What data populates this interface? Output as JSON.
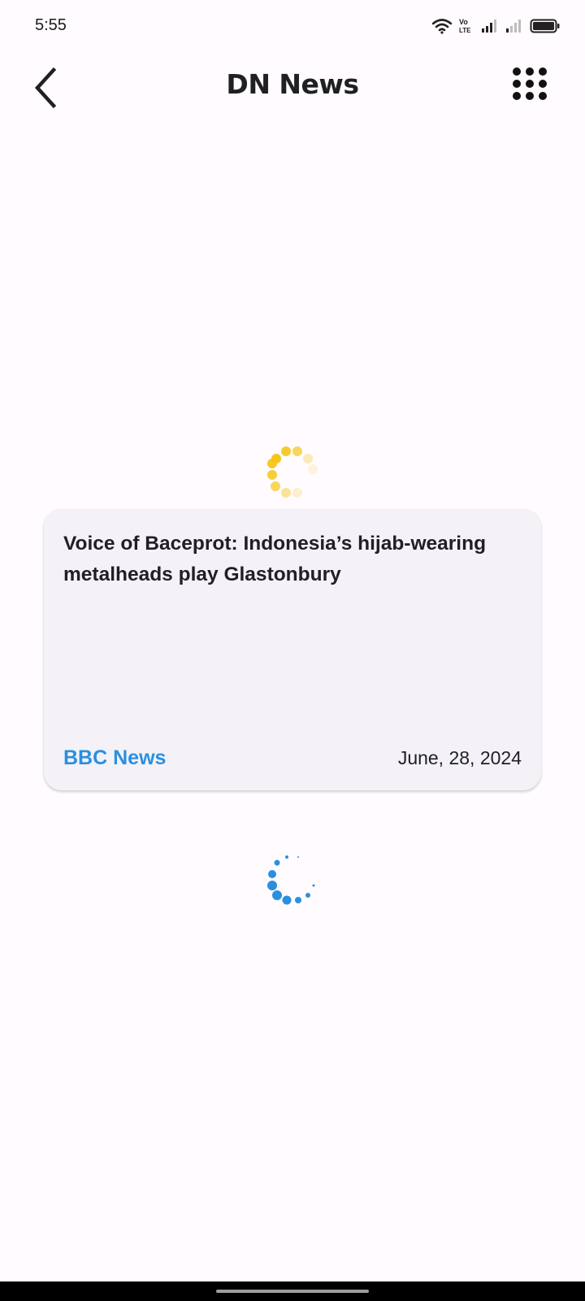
{
  "status_bar": {
    "time": "5:55",
    "volte_label_top": "Vo",
    "volte_label_bottom": "LTE",
    "icons": [
      "wifi-icon",
      "volte-icon",
      "signal-sim1-icon",
      "signal-sim2-icon",
      "battery-icon"
    ]
  },
  "app_bar": {
    "title": "DN News",
    "back_icon": "chevron-left-icon",
    "menu_icon": "grid-dots-icon"
  },
  "article": {
    "title": "Voice of Baceprot: Indonesia’s hijab-wearing metalheads play Glastonbury",
    "source": "BBC News",
    "date": "June, 28, 2024"
  },
  "colors": {
    "background": "#fffbfe",
    "card": "#f4f2f7",
    "accent_blue": "#2b8fe0",
    "spinner_yellow": "#f5c518",
    "text": "#1f1f24"
  }
}
